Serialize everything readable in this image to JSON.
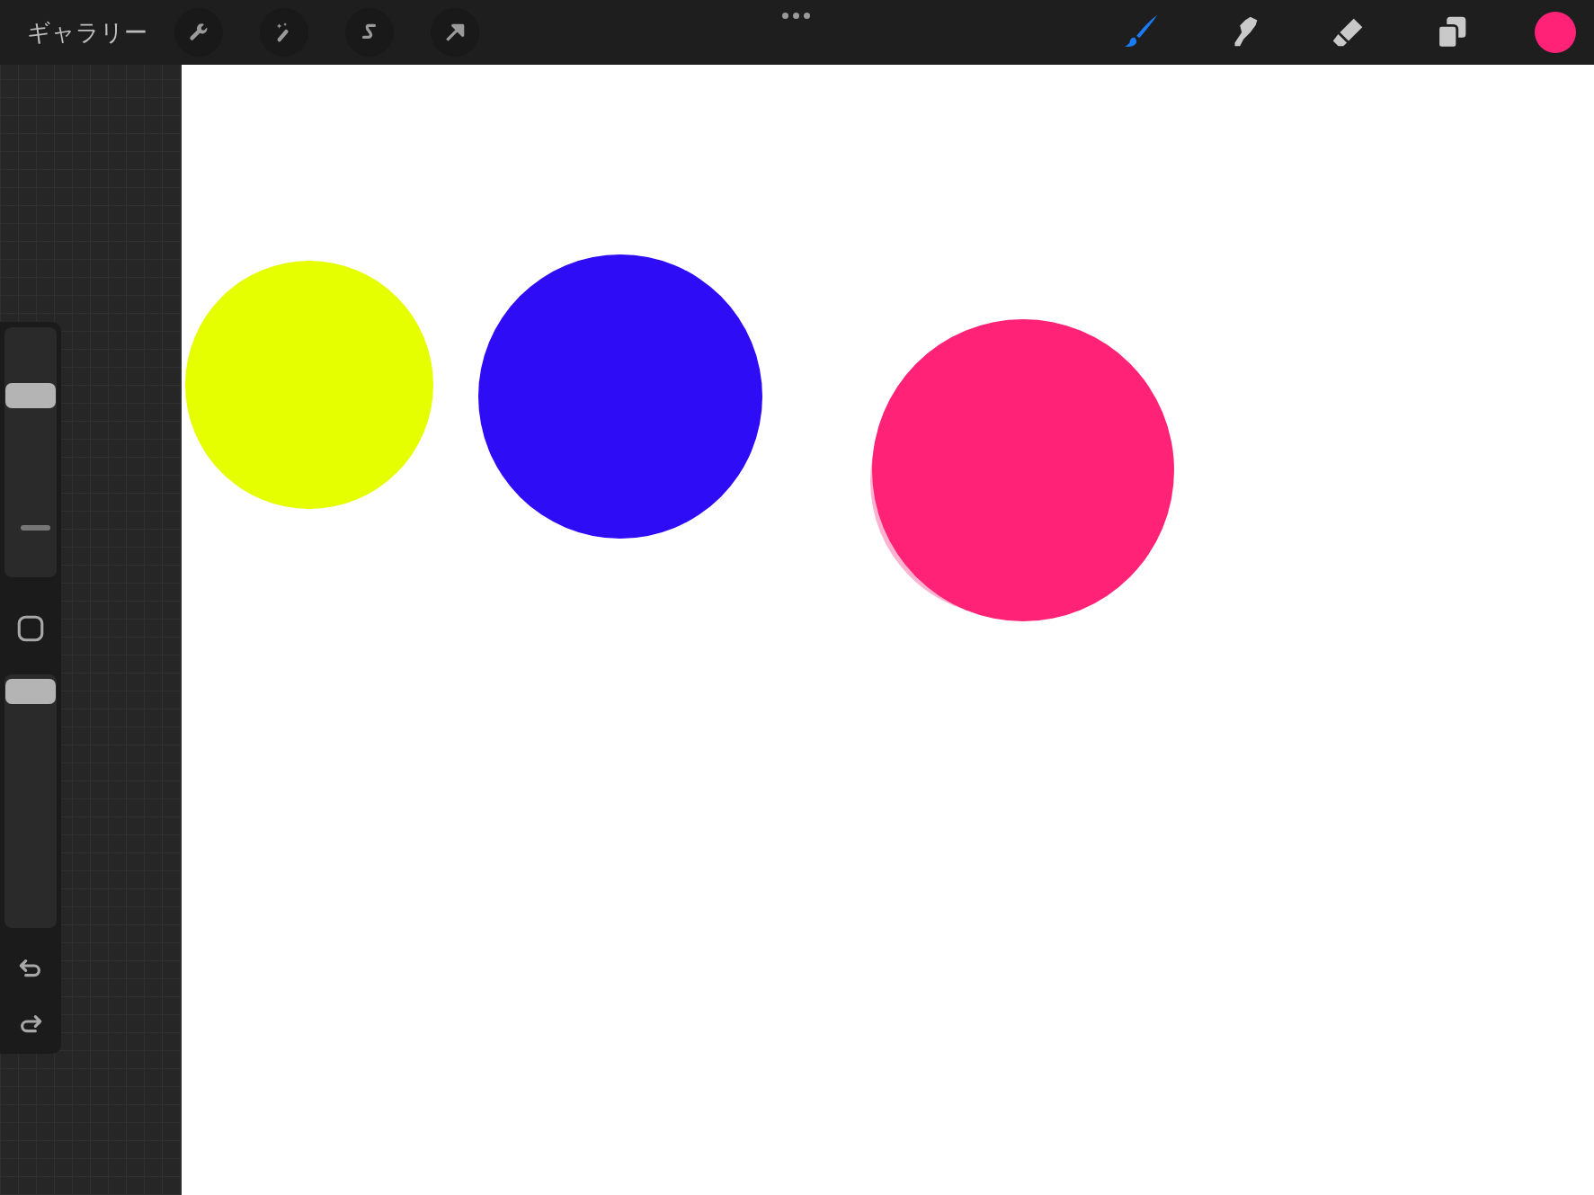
{
  "toolbar": {
    "gallery": "ギャラリー",
    "left_tools": [
      {
        "kind": "wrench"
      },
      {
        "kind": "wand"
      },
      {
        "kind": "selection"
      },
      {
        "kind": "arrow"
      }
    ],
    "right_tools": [
      {
        "kind": "brush",
        "selected": true
      },
      {
        "kind": "smudge",
        "selected": false
      },
      {
        "kind": "eraser",
        "selected": false
      },
      {
        "kind": "layers",
        "selected": false
      }
    ],
    "current_color": {
      "color": "#ff2277"
    }
  },
  "sidebar": {
    "brush_size": {
      "level": 0.72
    },
    "opacity": {
      "level": 0.98
    }
  },
  "canvas": {
    "strokes": [
      {
        "color": "#e5ff00"
      },
      {
        "color": "#2e0cf5"
      },
      {
        "color": "#ff2277"
      }
    ]
  }
}
